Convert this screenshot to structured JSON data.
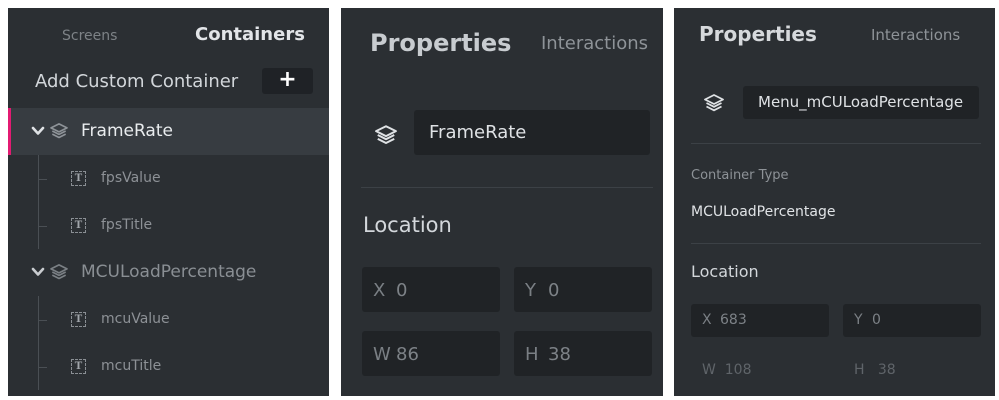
{
  "colors": {
    "accent": "#e31b72",
    "panel_bg": "#2b2f33",
    "field_bg": "#202326",
    "selected_row": "#373c41"
  },
  "left_panel": {
    "tabs": {
      "screens": "Screens",
      "containers": "Containers"
    },
    "add_container_label": "Add Custom Container",
    "add_button_label": "+",
    "tree": [
      {
        "name": "FrameRate",
        "icon": "layers-icon",
        "expanded": true,
        "selected": true,
        "children": [
          {
            "name": "fpsValue",
            "icon": "text-icon",
            "icon_glyph": "T"
          },
          {
            "name": "fpsTitle",
            "icon": "text-icon",
            "icon_glyph": "T"
          }
        ]
      },
      {
        "name": "MCULoadPercentage",
        "icon": "layers-icon",
        "expanded": true,
        "selected": false,
        "children": [
          {
            "name": "mcuValue",
            "icon": "text-icon",
            "icon_glyph": "T"
          },
          {
            "name": "mcuTitle",
            "icon": "text-icon",
            "icon_glyph": "T"
          }
        ]
      }
    ]
  },
  "middle_panel": {
    "tabs": {
      "properties": "Properties",
      "interactions": "Interactions"
    },
    "container_name": "FrameRate",
    "location_heading": "Location",
    "fields": {
      "x": {
        "label": "X",
        "value": "0"
      },
      "y": {
        "label": "Y",
        "value": "0"
      },
      "w": {
        "label": "W",
        "value": "86"
      },
      "h": {
        "label": "H",
        "value": "38"
      }
    }
  },
  "right_panel": {
    "tabs": {
      "properties": "Properties",
      "interactions": "Interactions"
    },
    "container_name": "Menu_mCULoadPercentage",
    "container_type_label": "Container Type",
    "container_type_value": "MCULoadPercentage",
    "location_heading": "Location",
    "fields": {
      "x": {
        "label": "X",
        "value": "683"
      },
      "y": {
        "label": "Y",
        "value": "0"
      },
      "w": {
        "label": "W",
        "value": "108"
      },
      "h": {
        "label": "H",
        "value": "38"
      }
    }
  }
}
